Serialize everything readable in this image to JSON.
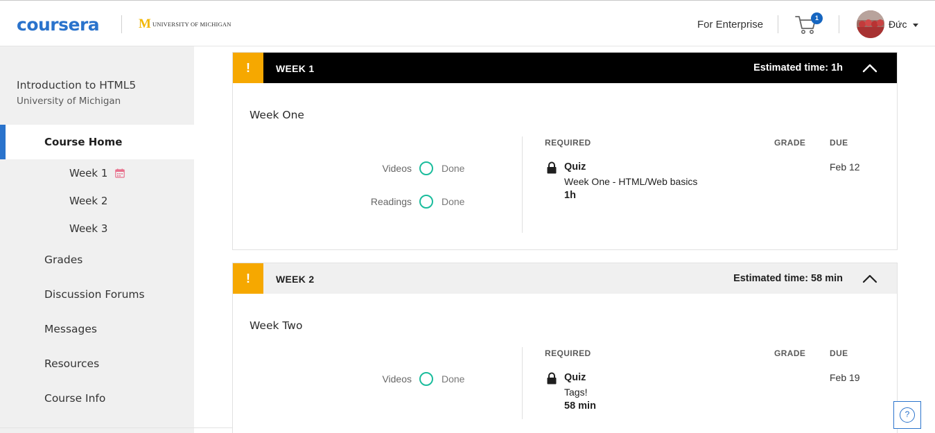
{
  "header": {
    "logo": "coursera",
    "partner_m": "M",
    "partner_name": "UNIVERSITY OF MICHIGAN",
    "enterprise_link": "For Enterprise",
    "cart_count": "1",
    "username": "Đức",
    "brand_color": "#2a73cc"
  },
  "sidebar": {
    "course_title": "Introduction to HTML5",
    "course_institution": "University of Michigan",
    "active_item": "Course Home",
    "weeks": [
      "Week 1",
      "Week 2",
      "Week 3"
    ],
    "items": [
      "Grades",
      "Discussion Forums",
      "Messages",
      "Resources",
      "Course Info"
    ]
  },
  "weeks": [
    {
      "alert_icon": "!",
      "label": "WEEK 1",
      "estimated_time": "Estimated time: 1h",
      "title": "Week One",
      "progress": [
        {
          "label": "Videos",
          "status": "Done"
        },
        {
          "label": "Readings",
          "status": "Done"
        }
      ],
      "columns": {
        "required": "REQUIRED",
        "grade": "GRADE",
        "due": "DUE"
      },
      "assignment": {
        "type": "Quiz",
        "name": "Week One - HTML/Web basics",
        "duration": "1h",
        "due": "Feb 12"
      }
    },
    {
      "alert_icon": "!",
      "label": "WEEK 2",
      "estimated_time": "Estimated time: 58 min",
      "title": "Week Two",
      "progress": [
        {
          "label": "Videos",
          "status": "Done"
        }
      ],
      "columns": {
        "required": "REQUIRED",
        "grade": "GRADE",
        "due": "DUE"
      },
      "assignment": {
        "type": "Quiz",
        "name": "Tags!",
        "duration": "58 min",
        "due": "Feb 19"
      }
    }
  ],
  "help_icon": "?",
  "colors": {
    "accent": "#2a73cc",
    "warning": "#f6a800",
    "done": "#1abc9c",
    "week_header_active": "#000000",
    "week_header_inactive": "#f0f0f0"
  }
}
